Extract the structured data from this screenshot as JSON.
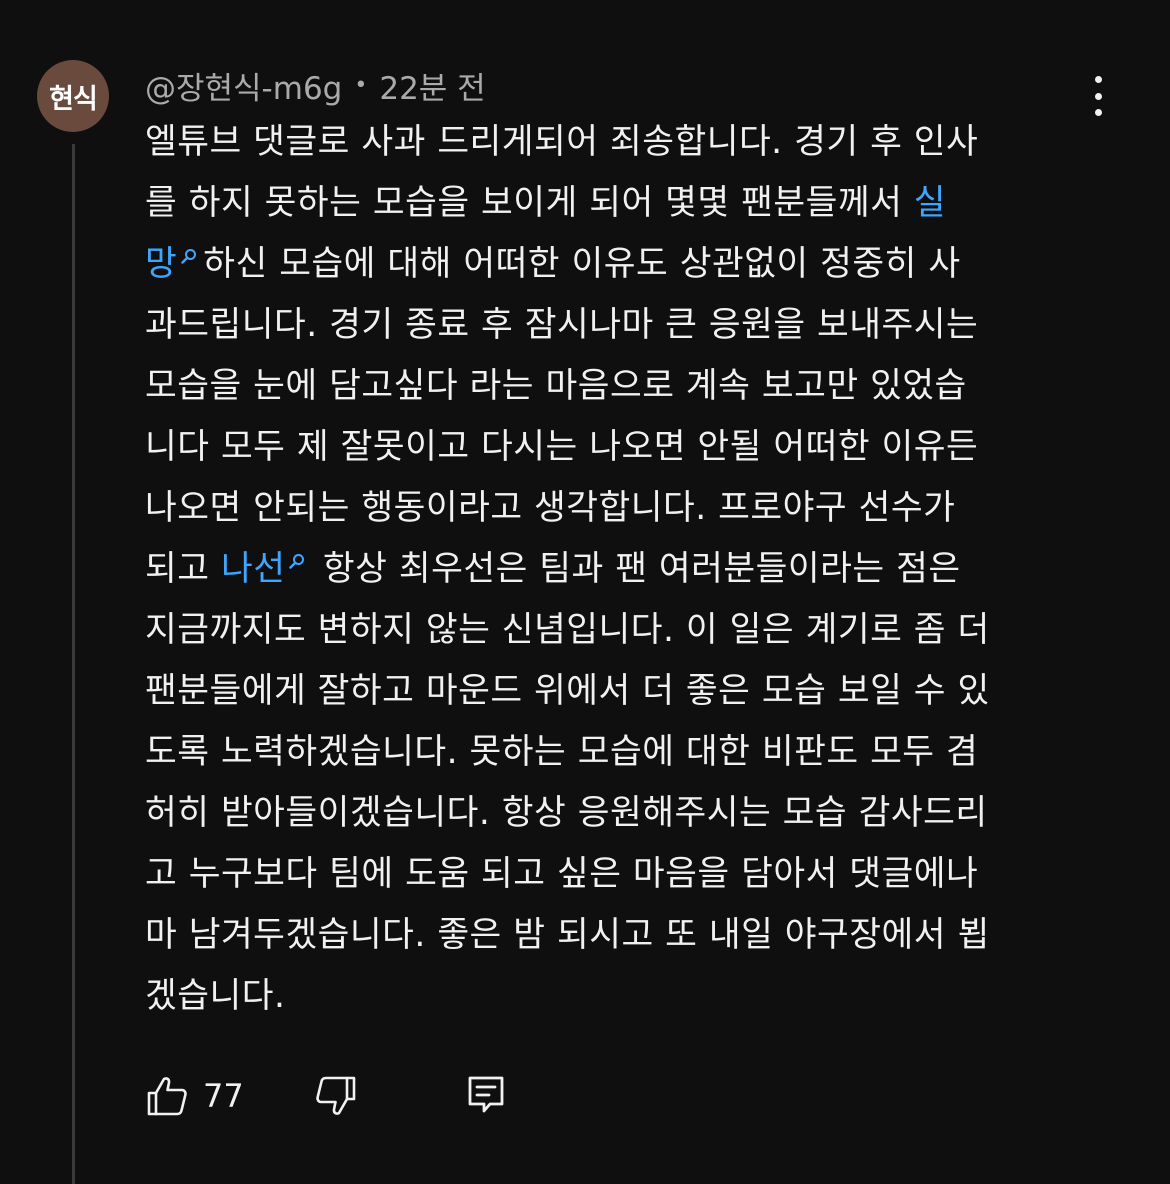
{
  "comment": {
    "avatar_text": "현식",
    "author": "@장현식-m6g",
    "separator": "•",
    "time": "22분 전",
    "lines": [
      "엘튜브 댓글로 사과 드리게되어 죄송합니다. 경기 후 인사",
      "를 하지 못하는 모습을 보이게 되어 몇몇 팬분들께서 ",
      "하신 모습에 대해 어떠한 이유도 상관없이 정중히 사",
      "과드립니다. 경기 종료 후 잠시나마 큰 응원을 보내주시는",
      "모습을 눈에 담고싶다 라는 마음으로 계속 보고만 있었습",
      "니다 모두 제 잘못이고 다시는 나오면 안될 어떠한 이유든",
      "나오면 안되는 행동이라고 생각합니다. 프로야구 선수가",
      "되고 ",
      " 항상 최우선은 팀과 팬 여러분들이라는 점은",
      "지금까지도 변하지 않는 신념입니다. 이 일은 계기로 좀 더",
      "팬분들에게 잘하고 마운드 위에서 더 좋은 모습 보일 수 있",
      "도록 노력하겠습니다. 못하는 모습에 대한 비판도 모두 겸",
      "허히 받아들이겠습니다. 항상 응원해주시는 모습 감사드리",
      "고 누구보다 팀에 도움 되고 싶은 마음을 담아서 댓글에나",
      "마 남겨두겠습니다. 좋은 밤 되시고 또 내일 야구장에서 뵙",
      "겠습니다."
    ],
    "links": {
      "silmang_part1": "실",
      "silmang_part2": "망",
      "naseon": "나선"
    },
    "like_count": "77"
  },
  "icons": {
    "menu": "more-vert-icon",
    "like": "thumbs-up-icon",
    "dislike": "thumbs-down-icon",
    "reply": "reply-comment-icon",
    "search": "search-icon"
  },
  "colors": {
    "background": "#0f0f0f",
    "text": "#f1f1f1",
    "meta": "#aaaaaa",
    "link": "#3ea6ff",
    "avatar": "#6b4a3e"
  }
}
